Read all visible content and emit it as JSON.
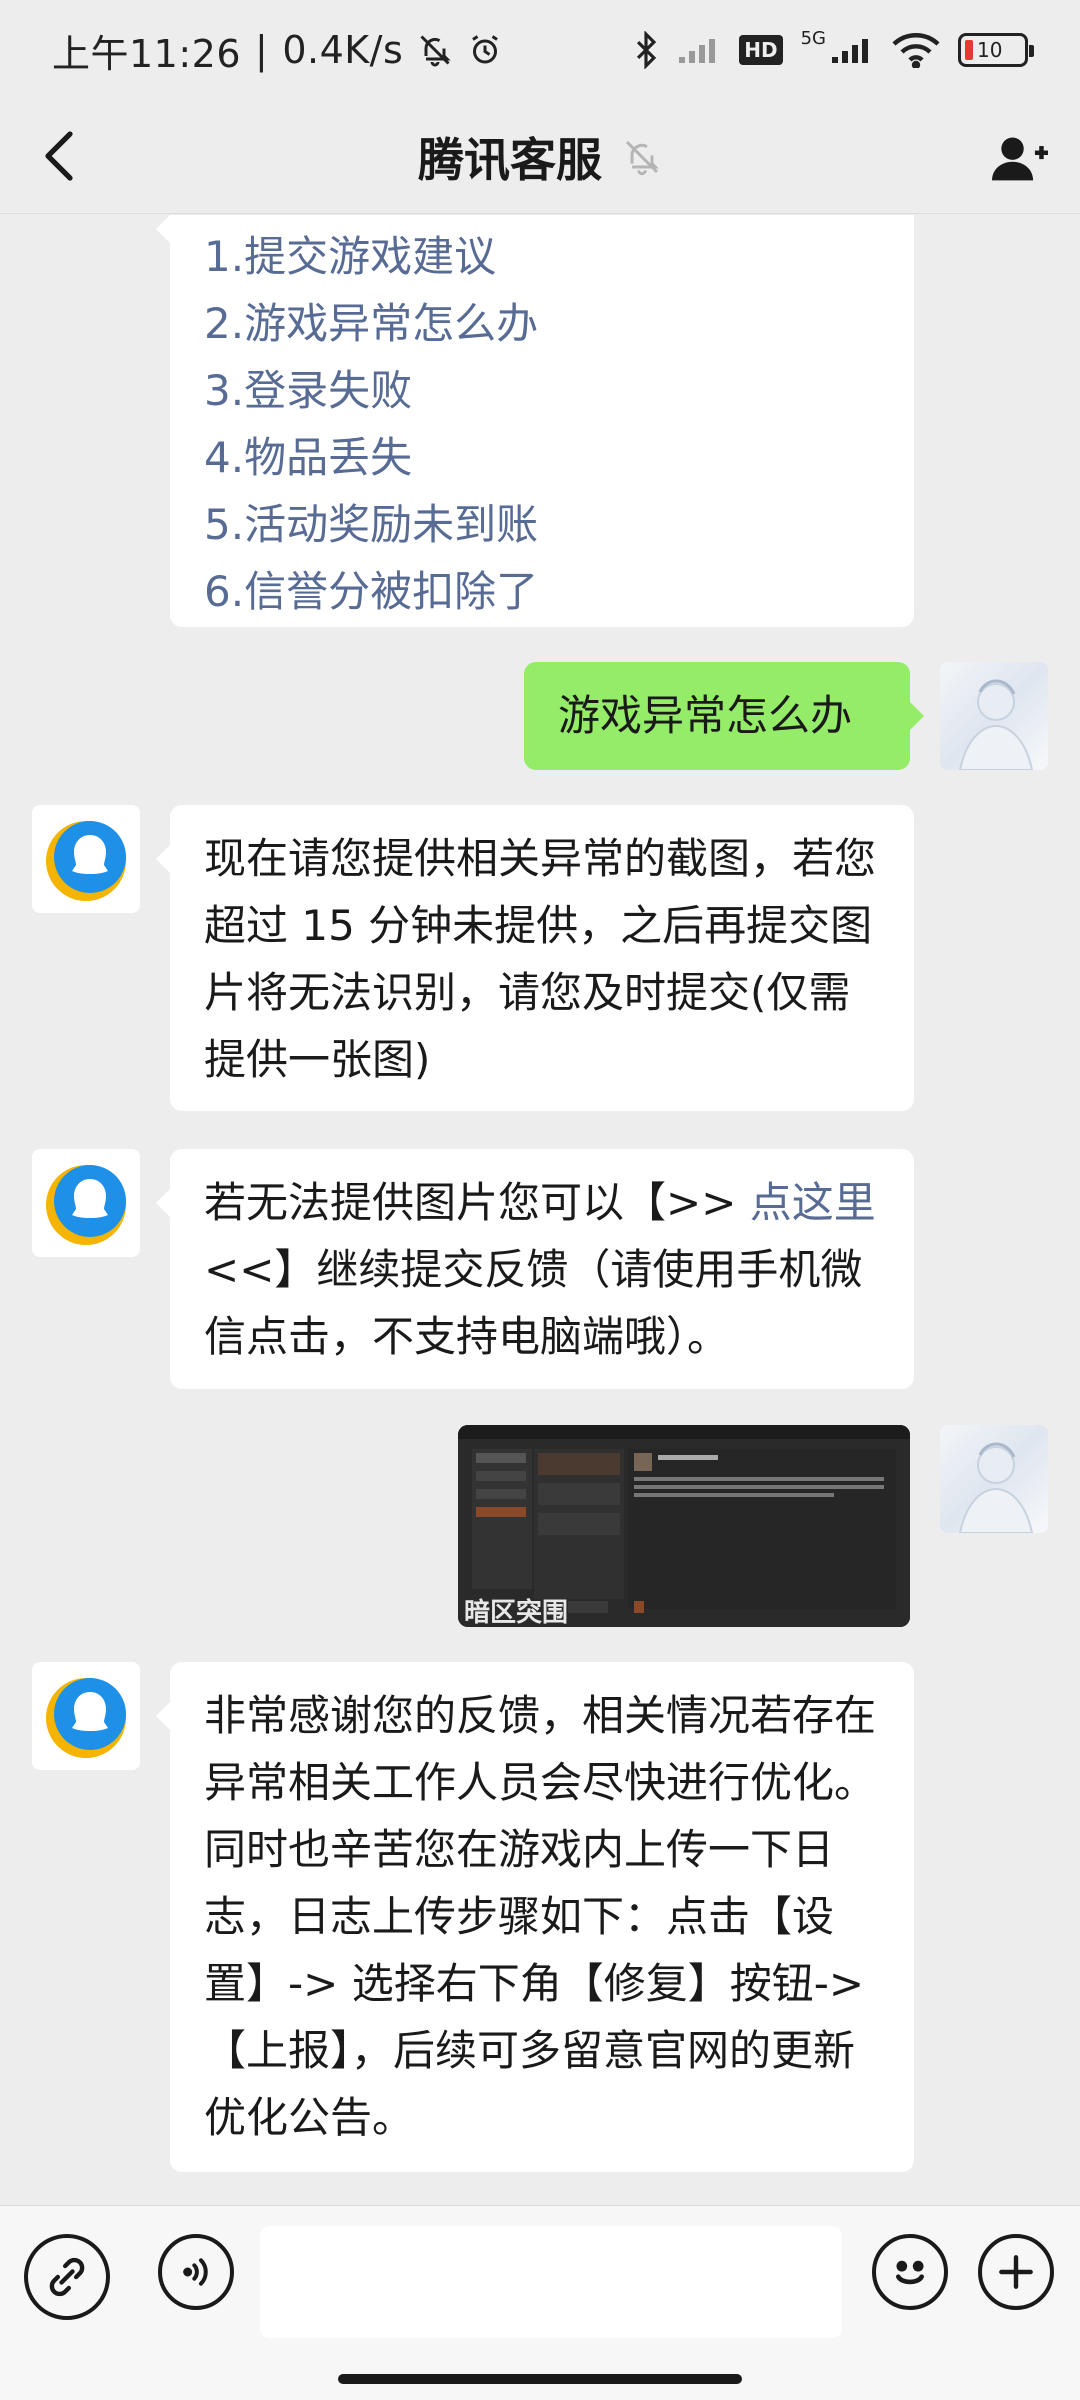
{
  "status_bar": {
    "time": "上午11:26",
    "speed": "0.4K/s",
    "hd_label": "HD",
    "network_label": "5G",
    "battery_level": "10"
  },
  "header": {
    "title": "腾讯客服"
  },
  "messages": {
    "menu_items": [
      "1.提交游戏建议",
      "2.游戏异常怎么办",
      "3.登录失败",
      "4.物品丢失",
      "5.活动奖励未到账",
      "6.信誉分被扣除了"
    ],
    "user_message": "游戏异常怎么办",
    "bot_reply_1": "现在请您提供相关异常的截图，若您超过 15 分钟未提供，之后再提交图片将无法识别，请您及时提交(仅需提供一张图)",
    "bot_reply_2_prefix": "若无法提供图片您可以【>> ",
    "bot_reply_2_link": "点这里",
    "bot_reply_2_suffix": " <<】继续提交反馈（请使用手机微信点击，不支持电脑端哦）。",
    "image_caption": "暗区突围",
    "bot_reply_3": "非常感谢您的反馈，相关情况若存在异常相关工作人员会尽快进行优化。同时也辛苦您在游戏内上传一下日志，日志上传步骤如下：点击【设置】-> 选择右下角【修复】按钮->【上报】，后续可多留意官网的更新优化公告。"
  },
  "colors": {
    "background": "#ededed",
    "user_bubble": "#95ec69",
    "link": "#576b95",
    "battery_low": "#e53935"
  },
  "icons": {
    "back": "chevron-left-icon",
    "mute": "bell-off-icon",
    "add_user": "add-user-icon",
    "voice": "voice-icon",
    "emoji": "emoji-icon",
    "more": "plus-icon"
  }
}
